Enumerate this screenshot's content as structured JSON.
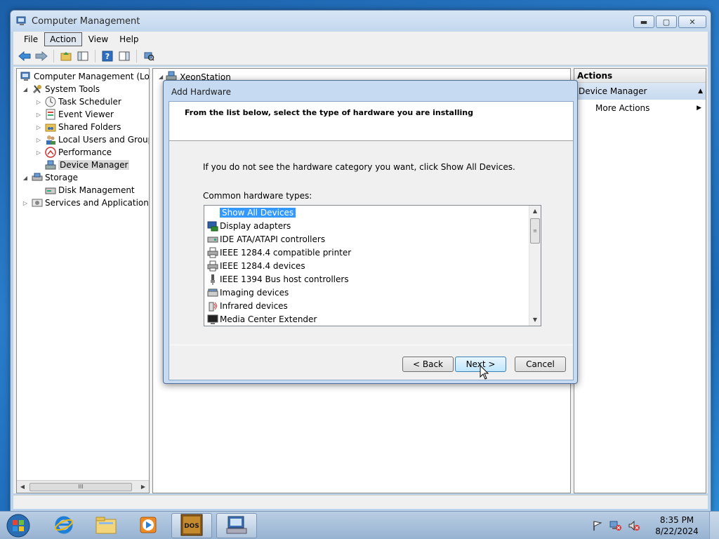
{
  "window": {
    "title": "Computer Management",
    "controls": {
      "minimize": "▬",
      "maximize": "▢",
      "close": "✕"
    }
  },
  "menubar": {
    "items": [
      "File",
      "Action",
      "View",
      "Help"
    ],
    "active": "Action"
  },
  "tree": {
    "items": [
      {
        "label": "Computer Management (Local",
        "level": 0,
        "arrow": "",
        "icon": "computer-management-icon"
      },
      {
        "label": "System Tools",
        "level": 1,
        "arrow": "◢",
        "icon": "tools-icon"
      },
      {
        "label": "Task Scheduler",
        "level": 2,
        "arrow": "▷",
        "icon": "clock-icon"
      },
      {
        "label": "Event Viewer",
        "level": 2,
        "arrow": "▷",
        "icon": "event-viewer-icon"
      },
      {
        "label": "Shared Folders",
        "level": 2,
        "arrow": "▷",
        "icon": "shared-folder-icon"
      },
      {
        "label": "Local Users and Groups",
        "level": 2,
        "arrow": "▷",
        "icon": "users-icon"
      },
      {
        "label": "Performance",
        "level": 2,
        "arrow": "▷",
        "icon": "performance-icon"
      },
      {
        "label": "Device Manager",
        "level": 2,
        "arrow": "",
        "icon": "device-manager-icon",
        "selected": true
      },
      {
        "label": "Storage",
        "level": 1,
        "arrow": "◢",
        "icon": "storage-icon"
      },
      {
        "label": "Disk Management",
        "level": 2,
        "arrow": "",
        "icon": "disk-icon"
      },
      {
        "label": "Services and Applications",
        "level": 1,
        "arrow": "▷",
        "icon": "services-icon"
      }
    ],
    "hscroll_thumb": "III"
  },
  "center": {
    "root_label": "XeonStation",
    "root_arrow": "◢"
  },
  "actions": {
    "header": "Actions",
    "section": "Device Manager",
    "section_arrow": "▲",
    "items": [
      {
        "label": "More Actions",
        "arrow": "▶"
      }
    ]
  },
  "dialog": {
    "title": "Add Hardware",
    "heading": "From the list below, select the type of hardware you are installing",
    "info": "If you do not see the hardware category you want, click Show All Devices.",
    "list_label": "Common hardware types:",
    "list_items": [
      {
        "label": "Show All Devices",
        "icon": "",
        "selected": true
      },
      {
        "label": "Display adapters",
        "icon": "display-adapter-icon"
      },
      {
        "label": "IDE ATA/ATAPI controllers",
        "icon": "ide-controller-icon"
      },
      {
        "label": "IEEE 1284.4 compatible printer",
        "icon": "printer-icon"
      },
      {
        "label": "IEEE 1284.4 devices",
        "icon": "printer-icon"
      },
      {
        "label": "IEEE 1394 Bus host controllers",
        "icon": "firewire-icon"
      },
      {
        "label": "Imaging devices",
        "icon": "scanner-icon"
      },
      {
        "label": "Infrared devices",
        "icon": "infrared-icon"
      },
      {
        "label": "Media Center Extender",
        "icon": "monitor-icon"
      }
    ],
    "buttons": {
      "back": "< Back",
      "next": "Next >",
      "cancel": "Cancel"
    }
  },
  "taskbar": {
    "apps": [
      {
        "name": "internet-explorer",
        "icon": "internet-explorer-icon",
        "open": false
      },
      {
        "name": "windows-explorer",
        "icon": "folder-icon",
        "open": false
      },
      {
        "name": "media-player",
        "icon": "media-player-icon",
        "open": false
      },
      {
        "name": "dosbox",
        "icon": "dosbox-icon",
        "open": true,
        "text": "DOS"
      },
      {
        "name": "computer-management",
        "icon": "computer-management-icon",
        "open": true
      }
    ],
    "clock": {
      "time": "8:35 PM",
      "date": "8/22/2024"
    }
  },
  "colors": {
    "selection": "#3399ff",
    "window_frame": "#bcd3ec",
    "taskbar": "#a8c0dc"
  }
}
